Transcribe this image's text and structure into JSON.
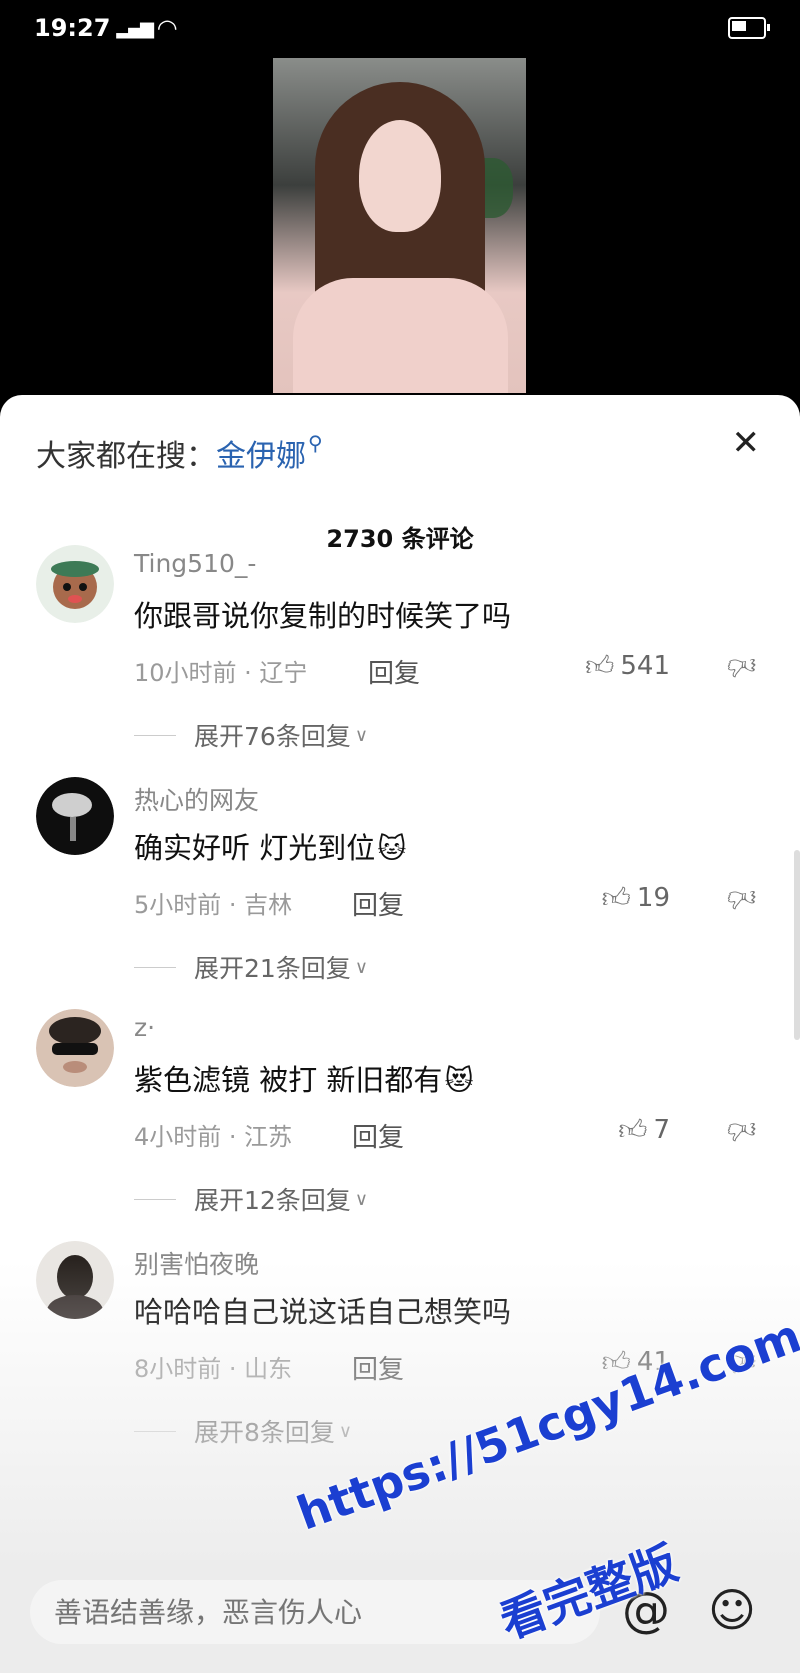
{
  "status_bar": {
    "time": "19:27",
    "signal_icon": "signal-icon",
    "wifi_icon": "wifi-icon",
    "battery_icon": "battery-icon"
  },
  "search_hint": {
    "label": "大家都在搜：",
    "term": "金伊娜",
    "icon": "search-icon"
  },
  "close_icon": "close-icon",
  "comment_count": "2730 条评论",
  "comments": [
    {
      "username": "Ting510_-",
      "text": "你跟哥说你复制的时候笑了吗",
      "emoji": "",
      "meta": "10小时前 · 辽宁",
      "reply_label": "回复",
      "likes": "541",
      "expand_label": "展开76条回复"
    },
    {
      "username": "热心的网友",
      "text": "确实好听 灯光到位",
      "emoji": "🐱",
      "meta": "5小时前 · 吉林",
      "reply_label": "回复",
      "likes": "19",
      "expand_label": "展开21条回复"
    },
    {
      "username": "z·",
      "text": "紫色滤镜 被打 新旧都有",
      "emoji": "😻",
      "meta": "4小时前 · 江苏",
      "reply_label": "回复",
      "likes": "7",
      "expand_label": "展开12条回复"
    },
    {
      "username": "别害怕夜晚",
      "text": "哈哈哈自己说这话自己想笑吗",
      "emoji": "",
      "meta": "8小时前 · 山东",
      "reply_label": "回复",
      "likes": "41",
      "expand_label": "展开8条回复"
    }
  ],
  "input_bar": {
    "placeholder": "善语结善缘，恶言伤人心",
    "at_icon": "at-icon",
    "emoji_icon": "emoji-icon"
  },
  "watermark": {
    "url": "https://51cgy14.com",
    "sub": "看完整版"
  }
}
